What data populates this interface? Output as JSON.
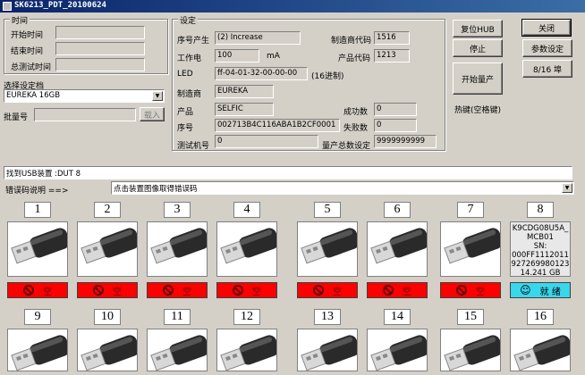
{
  "title": "SK6213_PDT_20100624",
  "time_group": {
    "legend": "时间",
    "start_label": "开始时间",
    "end_label": "结束时间",
    "total_label": "总测试时间",
    "start_value": "",
    "end_value": "",
    "total_value": ""
  },
  "profile": {
    "label": "选择设定档",
    "selected": "EUREKA  16GB",
    "batch_label": "批量号",
    "batch_value": "",
    "load_button": "载入"
  },
  "settings": {
    "legend": "设定",
    "serial_gen_label": "序号产生",
    "serial_gen_value": "(2) Increase",
    "vendor_code_label": "制造商代码",
    "vendor_code_value": "1516",
    "current_label": "工作电",
    "current_value": "100",
    "current_unit": "mA",
    "product_code_label": "产品代码",
    "product_code_value": "1213",
    "led_label": "LED",
    "led_value": "ff-04-01-32-00-00-00",
    "led_note": "(16进制)",
    "maker_label": "制造商",
    "maker_value": "EUREKA",
    "product_label": "产品",
    "product_value": "SELFIC",
    "success_label": "成功数",
    "success_value": "0",
    "serial_label": "序号",
    "serial_value": "002713B4C116ABA1B2CF0001",
    "fail_label": "失败数",
    "fail_value": "0",
    "tester_label": "测试机号",
    "tester_value": "0",
    "total_setting_label": "量产总数设定",
    "total_setting_value": "9999999999"
  },
  "buttons": {
    "reset_hub": "复位HUB",
    "close": "关闭",
    "stop": "停止",
    "param_settings": "参数设定",
    "port_toggle": "8/16 埠",
    "start": "开始量产",
    "hotkey_note": "热键(空格键)"
  },
  "usb_found": "找到USB装置 :DUT 8",
  "error_label": "错误码说明 ==>",
  "error_selected": "点击装置图像取得错误码",
  "ports_row1": [
    {
      "num": "1",
      "status": "空"
    },
    {
      "num": "2",
      "status": "空"
    },
    {
      "num": "3",
      "status": "空"
    },
    {
      "num": "4",
      "status": "空"
    },
    {
      "num": "5",
      "status": "空"
    },
    {
      "num": "6",
      "status": "空"
    },
    {
      "num": "7",
      "status": "空"
    },
    {
      "num": "8",
      "status": "就 绪"
    }
  ],
  "port8_info": {
    "line1": "K9CDG08U5A_",
    "line2": "MCB01",
    "line3": "SN:",
    "line4": "000FF1112011",
    "line5": "927269980123",
    "line6": "14.241 GB"
  },
  "ports_row2": [
    "9",
    "10",
    "11",
    "12",
    "13",
    "14",
    "15",
    "16"
  ],
  "colors": {
    "empty": "#ff0000",
    "ready": "#3ad6ec",
    "titlebar": "#0a246a"
  }
}
